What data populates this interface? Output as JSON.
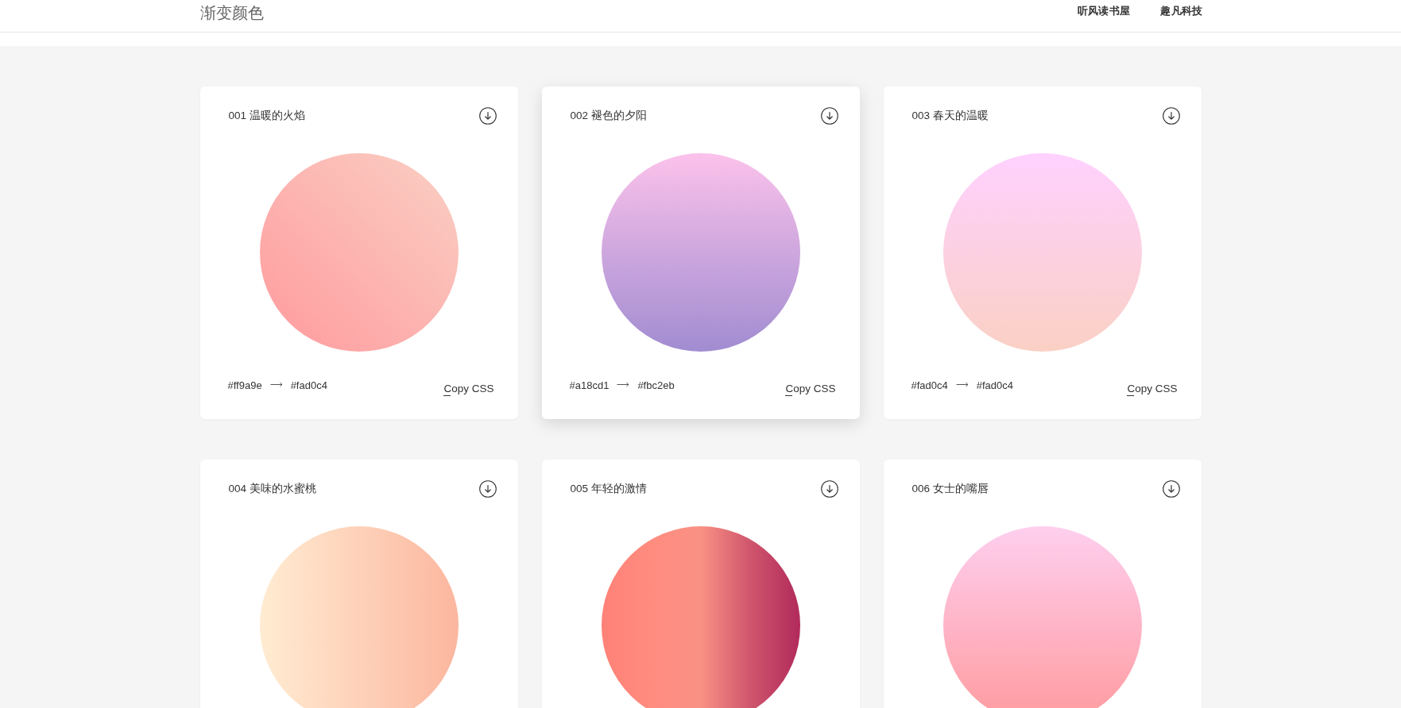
{
  "header": {
    "title": "渐变颜色",
    "links": [
      "听风读书屋",
      "趣凡科技"
    ]
  },
  "cards": [
    {
      "title": "001 温暖的火焰",
      "hovered": false,
      "kind": "diagonal",
      "gradient": [
        {
          "color": "#ff9a9e"
        },
        {
          "color": "#fad0c4"
        }
      ],
      "from": "#ff9a9e",
      "to": "#fad0c4",
      "copy_label": "Copy CSS"
    },
    {
      "title": "002 褪色的夕阳",
      "hovered": true,
      "kind": "vertical",
      "gradient": [
        {
          "color": "#a18cd1"
        },
        {
          "color": "#fbc2eb"
        }
      ],
      "from": "#a18cd1",
      "to": "#fbc2eb",
      "copy_label": "Copy CSS"
    },
    {
      "title": "003 春天的温暖",
      "hovered": false,
      "kind": "vertical",
      "gradient": [
        {
          "color": "#fad0c4"
        },
        {
          "color": "#ffd1ff"
        }
      ],
      "from": "#fad0c4",
      "to": "#fad0c4",
      "copy_label": "Copy CSS"
    },
    {
      "title": "004 美味的水蜜桃",
      "hovered": false,
      "kind": "horizontal",
      "gradient": [
        {
          "color": "#ffecd2"
        },
        {
          "color": "#fcb69f"
        }
      ]
    },
    {
      "title": "005 年轻的激情",
      "hovered": false,
      "kind": "horizontal",
      "gradient": [
        {
          "color": "#ff8177"
        },
        {
          "color": "#ff8c7f"
        },
        {
          "color": "#f99185"
        },
        {
          "color": "#cf556c"
        },
        {
          "color": "#b12a5b"
        }
      ]
    },
    {
      "title": "006 女士的嘴唇",
      "hovered": false,
      "kind": "vertical",
      "gradient": [
        {
          "color": "#ff9a9e"
        },
        {
          "color": "#fecfef"
        }
      ]
    }
  ]
}
